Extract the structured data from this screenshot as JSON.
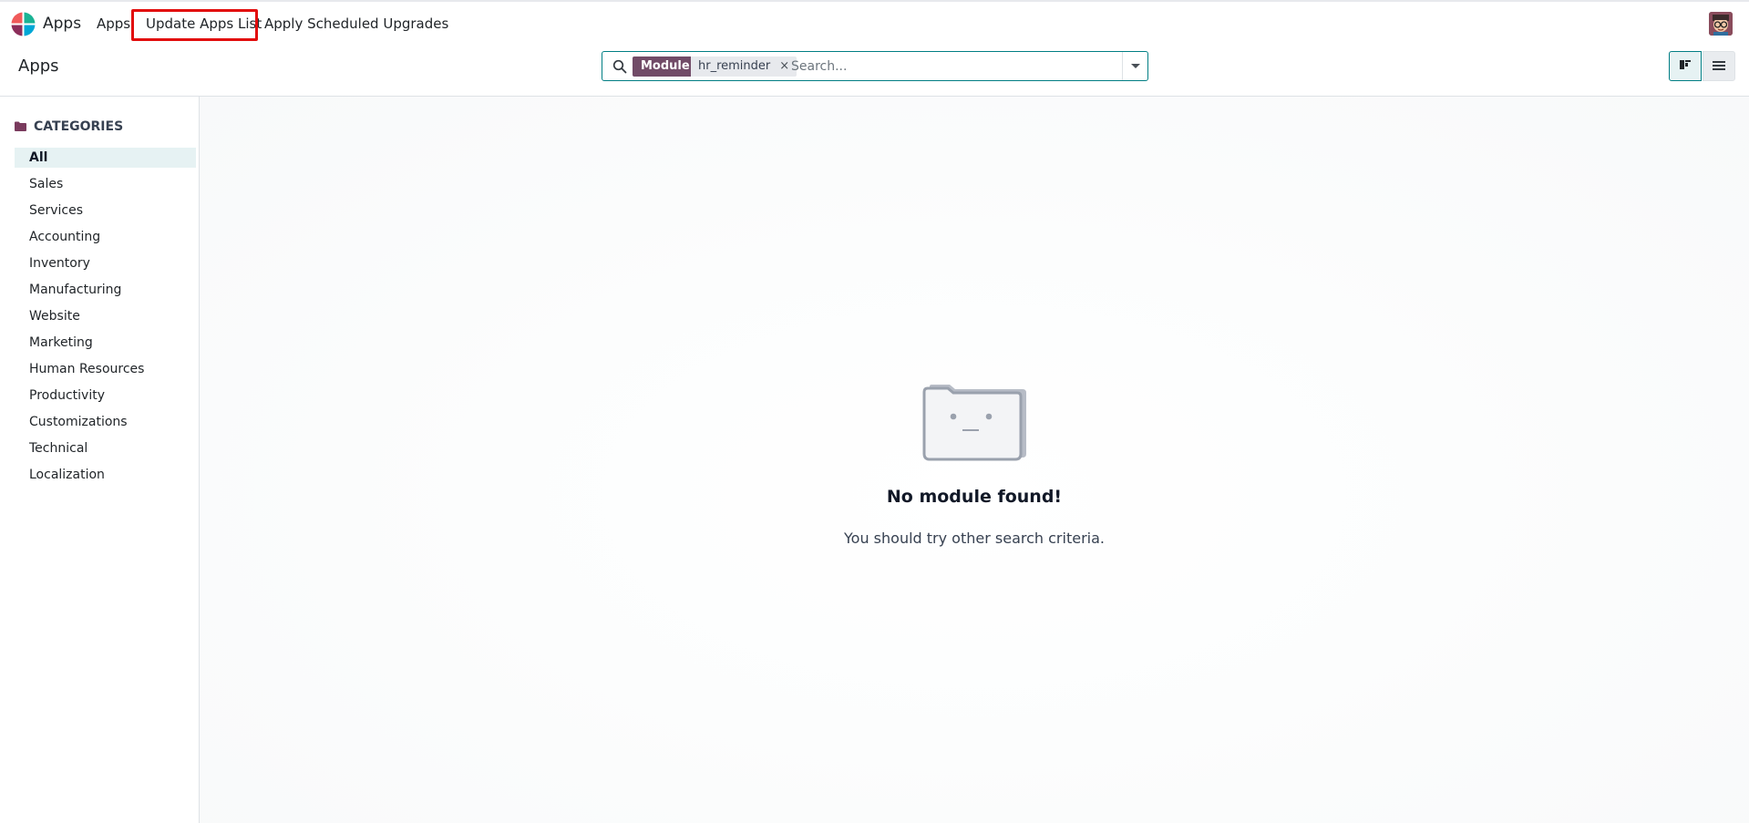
{
  "topbar": {
    "app_name": "Apps",
    "menu": {
      "apps": "Apps",
      "update_apps_list": "Update Apps List",
      "apply_scheduled_upgrades": "Apply Scheduled Upgrades"
    },
    "highlight_color": "#e20d0d"
  },
  "controlbar": {
    "breadcrumb": "Apps",
    "search": {
      "facet_label": "Module",
      "facet_value": "hr_reminder",
      "facet_remove": "×",
      "placeholder": "Search..."
    },
    "views": [
      "kanban",
      "list"
    ],
    "active_view": "kanban"
  },
  "sidebar": {
    "header": "CATEGORIES",
    "items": [
      {
        "label": "All",
        "active": true
      },
      {
        "label": "Sales"
      },
      {
        "label": "Services"
      },
      {
        "label": "Accounting"
      },
      {
        "label": "Inventory"
      },
      {
        "label": "Manufacturing"
      },
      {
        "label": "Website"
      },
      {
        "label": "Marketing"
      },
      {
        "label": "Human Resources"
      },
      {
        "label": "Productivity"
      },
      {
        "label": "Customizations"
      },
      {
        "label": "Technical"
      },
      {
        "label": "Localization"
      }
    ]
  },
  "empty_state": {
    "title": "No module found!",
    "subtitle": "You should try other search criteria."
  },
  "colors": {
    "brand": "#714b67",
    "accent": "#017e84",
    "active_bg": "#e6f2f3"
  }
}
